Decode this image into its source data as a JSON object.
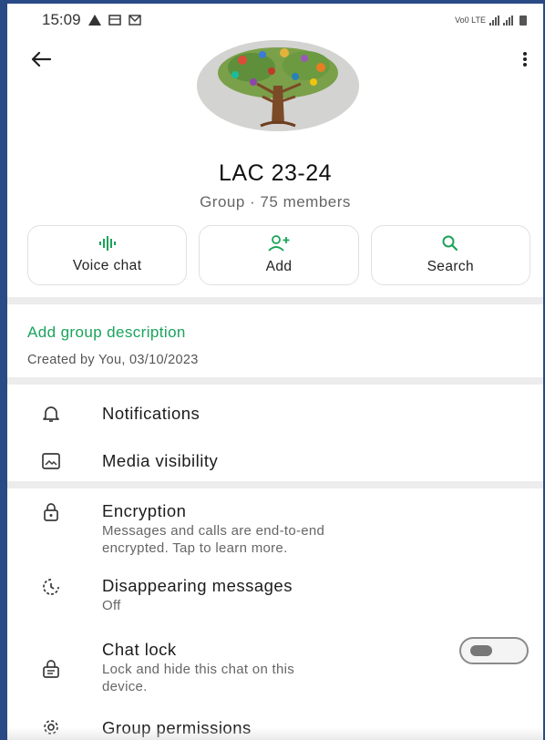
{
  "status_bar": {
    "time": "15:09",
    "network_label": "Vo0 LTE"
  },
  "header": {
    "group_name": "LAC 23-24",
    "group_info": "Group · 75 members"
  },
  "actions": [
    {
      "label": "Voice chat",
      "icon": "voice-waveform-icon"
    },
    {
      "label": "Add",
      "icon": "add-person-icon"
    },
    {
      "label": "Search",
      "icon": "search-icon"
    }
  ],
  "description": {
    "link": "Add group description",
    "created": "Created by You, 03/10/2023"
  },
  "settings": {
    "notifications": {
      "label": "Notifications"
    },
    "media": {
      "label": "Media visibility"
    },
    "encryption": {
      "label": "Encryption",
      "sub_line1": "Messages and calls are end-to-end",
      "sub_line2": "encrypted. Tap to learn more."
    },
    "disappearing": {
      "label": "Disappearing messages",
      "value": "Off"
    },
    "chat_lock": {
      "label": "Chat lock",
      "sub_line1": "Lock and hide this chat on this",
      "sub_line2": "device.",
      "enabled": false
    },
    "permissions": {
      "label": "Group permissions"
    }
  },
  "colors": {
    "accent_green": "#1aa35a",
    "frame_blue": "#2a4a86",
    "icon_grey": "#3a3a3a"
  }
}
